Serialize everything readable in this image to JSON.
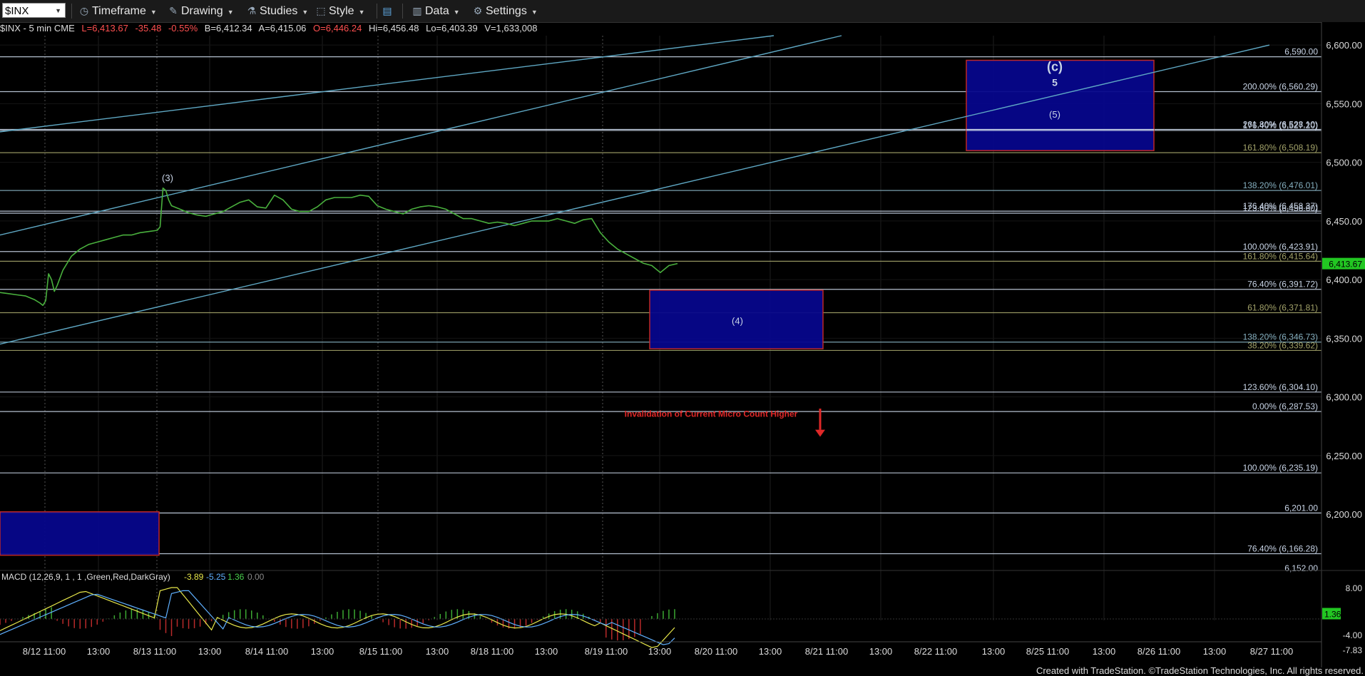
{
  "toolbar": {
    "symbol": "$INX",
    "buttons": [
      {
        "label": "Timeframe",
        "icon": "clock-icon"
      },
      {
        "label": "Drawing",
        "icon": "pencil-icon"
      },
      {
        "label": "Studies",
        "icon": "flask-icon"
      },
      {
        "label": "Style",
        "icon": "style-icon"
      },
      {
        "label": "",
        "icon": "layout-icon"
      },
      {
        "label": "Data",
        "icon": "bar-chart-icon"
      },
      {
        "label": "Settings",
        "icon": "gear-icon"
      }
    ]
  },
  "info": {
    "symbol_desc": "$INX - 5 min  CME",
    "last": "L=6,413.67",
    "change": "-35.48",
    "change_pct": "-0.55%",
    "bid": "B=6,412.34",
    "ask": "A=6,415.06",
    "open": "O=6,446.24",
    "high": "Hi=6,456.48",
    "low": "Lo=6,403.39",
    "volume": "V=1,633,008"
  },
  "colors": {
    "background": "#000000",
    "price": "#49b03d",
    "trendline": "#5fa8c4",
    "level_white": "#c8d4e6",
    "level_olive": "#a3a36a",
    "box_fill": "#07078c",
    "box_border": "#c82a2a",
    "negative": "#ff4040",
    "last_price_bg": "#22c722"
  },
  "chart_data": {
    "type": "line",
    "title": "$INX - 5 min",
    "y_axis": {
      "range": [
        6152,
        6608
      ],
      "ticks": [
        6600,
        6550,
        6500,
        6450,
        6400,
        6350,
        6300,
        6250,
        6200
      ]
    },
    "x_axis_labels": [
      "8/12 11:00",
      "13:00",
      "8/13 11:00",
      "13:00",
      "8/14 11:00",
      "13:00",
      "8/15 11:00",
      "13:00",
      "8/18 11:00",
      "13:00",
      "8/19 11:00",
      "13:00",
      "8/20 11:00",
      "13:00",
      "8/21 11:00",
      "13:00",
      "8/22 11:00",
      "13:00",
      "8/25 11:00",
      "13:00",
      "8/26 11:00",
      "13:00",
      "8/27 11:00"
    ],
    "series": [
      {
        "values": [
          [
            0,
            6389
          ],
          [
            3,
            6388
          ],
          [
            6,
            6387
          ],
          [
            9,
            6386
          ],
          [
            12,
            6383
          ],
          [
            14,
            6380
          ],
          [
            15,
            6378
          ],
          [
            16,
            6382
          ],
          [
            17,
            6405
          ],
          [
            18,
            6400
          ],
          [
            19,
            6390
          ],
          [
            20,
            6395
          ],
          [
            22,
            6408
          ],
          [
            25,
            6420
          ],
          [
            28,
            6426
          ],
          [
            31,
            6430
          ],
          [
            34,
            6432
          ],
          [
            37,
            6434
          ],
          [
            40,
            6436
          ],
          [
            43,
            6438
          ],
          [
            46,
            6438
          ],
          [
            49,
            6440
          ],
          [
            52,
            6441
          ],
          [
            55,
            6442
          ],
          [
            56,
            6445
          ],
          [
            57,
            6478
          ],
          [
            58,
            6476
          ],
          [
            59,
            6468
          ],
          [
            60,
            6463
          ],
          [
            63,
            6460
          ],
          [
            66,
            6457
          ],
          [
            69,
            6455
          ],
          [
            72,
            6454
          ],
          [
            75,
            6456
          ],
          [
            78,
            6458
          ],
          [
            81,
            6462
          ],
          [
            84,
            6466
          ],
          [
            87,
            6468
          ],
          [
            90,
            6462
          ],
          [
            93,
            6461
          ],
          [
            96,
            6472
          ],
          [
            99,
            6468
          ],
          [
            102,
            6460
          ],
          [
            105,
            6458
          ],
          [
            108,
            6458
          ],
          [
            111,
            6462
          ],
          [
            114,
            6468
          ],
          [
            117,
            6470
          ],
          [
            120,
            6470
          ],
          [
            123,
            6470
          ],
          [
            126,
            6472
          ],
          [
            129,
            6471
          ],
          [
            132,
            6463
          ],
          [
            135,
            6460
          ],
          [
            138,
            6458
          ],
          [
            141,
            6456
          ],
          [
            144,
            6460
          ],
          [
            147,
            6462
          ],
          [
            150,
            6463
          ],
          [
            153,
            6462
          ],
          [
            156,
            6460
          ],
          [
            159,
            6456
          ],
          [
            162,
            6452
          ],
          [
            165,
            6452
          ],
          [
            168,
            6450
          ],
          [
            171,
            6448
          ],
          [
            174,
            6449
          ],
          [
            177,
            6448
          ],
          [
            180,
            6446
          ],
          [
            183,
            6448
          ],
          [
            186,
            6450
          ],
          [
            189,
            6450
          ],
          [
            192,
            6450
          ],
          [
            195,
            6452
          ],
          [
            198,
            6450
          ],
          [
            201,
            6448
          ],
          [
            204,
            6451
          ],
          [
            207,
            6452
          ],
          [
            210,
            6440
          ],
          [
            213,
            6432
          ],
          [
            216,
            6426
          ],
          [
            219,
            6422
          ],
          [
            222,
            6418
          ],
          [
            225,
            6414
          ],
          [
            228,
            6412
          ],
          [
            231,
            6406
          ],
          [
            234,
            6412
          ],
          [
            237,
            6413.67
          ]
        ]
      }
    ],
    "macd": {
      "label": "MACD (12,26,9, 1 , 1 ,Green,Red,DarkGray)",
      "values": [
        "-3.89",
        "-5.25",
        "1.36",
        "0.00"
      ],
      "value_colors": [
        "#e8e84a",
        "#5fb0ff",
        "#49d04d",
        "#888888"
      ],
      "y_ticks": [
        "8.00",
        "-4.00",
        "-7.83"
      ],
      "last_hist": "1.36"
    },
    "levels": [
      {
        "price": 6590.0,
        "label": "6,590.00",
        "color": "#c8d4e6"
      },
      {
        "price": 6560.29,
        "label": "200.00% (6,560.29)",
        "color": "#c8d4e6"
      },
      {
        "price": 6528.1,
        "label": "261.80% (6,528.10)",
        "color": "#c8d4e6"
      },
      {
        "price": 6527.2,
        "label": "176.40% (6,527.20)",
        "color": "#c8d4e6"
      },
      {
        "price": 6508.19,
        "label": "161.80% (6,508.19)",
        "color": "#a3a36a"
      },
      {
        "price": 6476.01,
        "label": "138.20% (6,476.01)",
        "color": "#86b0c0"
      },
      {
        "price": 6458.37,
        "label": "176.40% (6,458.37)",
        "color": "#c8d4e6"
      },
      {
        "price": 6456.6,
        "label": "123.60% (6,456.60)",
        "color": "#c8d4e6"
      },
      {
        "price": 6423.91,
        "label": "100.00% (6,423.91)",
        "color": "#c8d4e6"
      },
      {
        "price": 6415.64,
        "label": "161.80% (6,415.64)",
        "color": "#a3a36a"
      },
      {
        "price": 6391.72,
        "label": "76.40% (6,391.72)",
        "color": "#c8d4e6"
      },
      {
        "price": 6371.81,
        "label": "61.80% (6,371.81)",
        "color": "#a3a36a"
      },
      {
        "price": 6346.73,
        "label": "138.20% (6,346.73)",
        "color": "#86b0c0"
      },
      {
        "price": 6339.62,
        "label": "38.20% (6,339.62)",
        "color": "#a3a36a"
      },
      {
        "price": 6304.1,
        "label": "123.60% (6,304.10)",
        "color": "#c8d4e6"
      },
      {
        "price": 6287.53,
        "label": "0.00% (6,287.53)",
        "color": "#c8d4e6"
      },
      {
        "price": 6235.19,
        "label": "100.00% (6,235.19)",
        "color": "#c8d4e6"
      },
      {
        "price": 6201.0,
        "label": "6,201.00",
        "color": "#c8d4e6"
      },
      {
        "price": 6166.28,
        "label": "76.40% (6,166.28)",
        "color": "#c8d4e6"
      }
    ],
    "annotations": [
      {
        "text": "(3)"
      },
      {
        "text": "(4)"
      },
      {
        "text": "(c)"
      },
      {
        "text": "5"
      },
      {
        "text": "(5)"
      },
      {
        "text": "Invalidation of Current Micro Count Higher"
      }
    ],
    "last_price": "6,413.67",
    "bottom_clip_label": "6,152.00"
  },
  "footer": "Created with TradeStation. ©TradeStation Technologies, Inc. All rights reserved."
}
